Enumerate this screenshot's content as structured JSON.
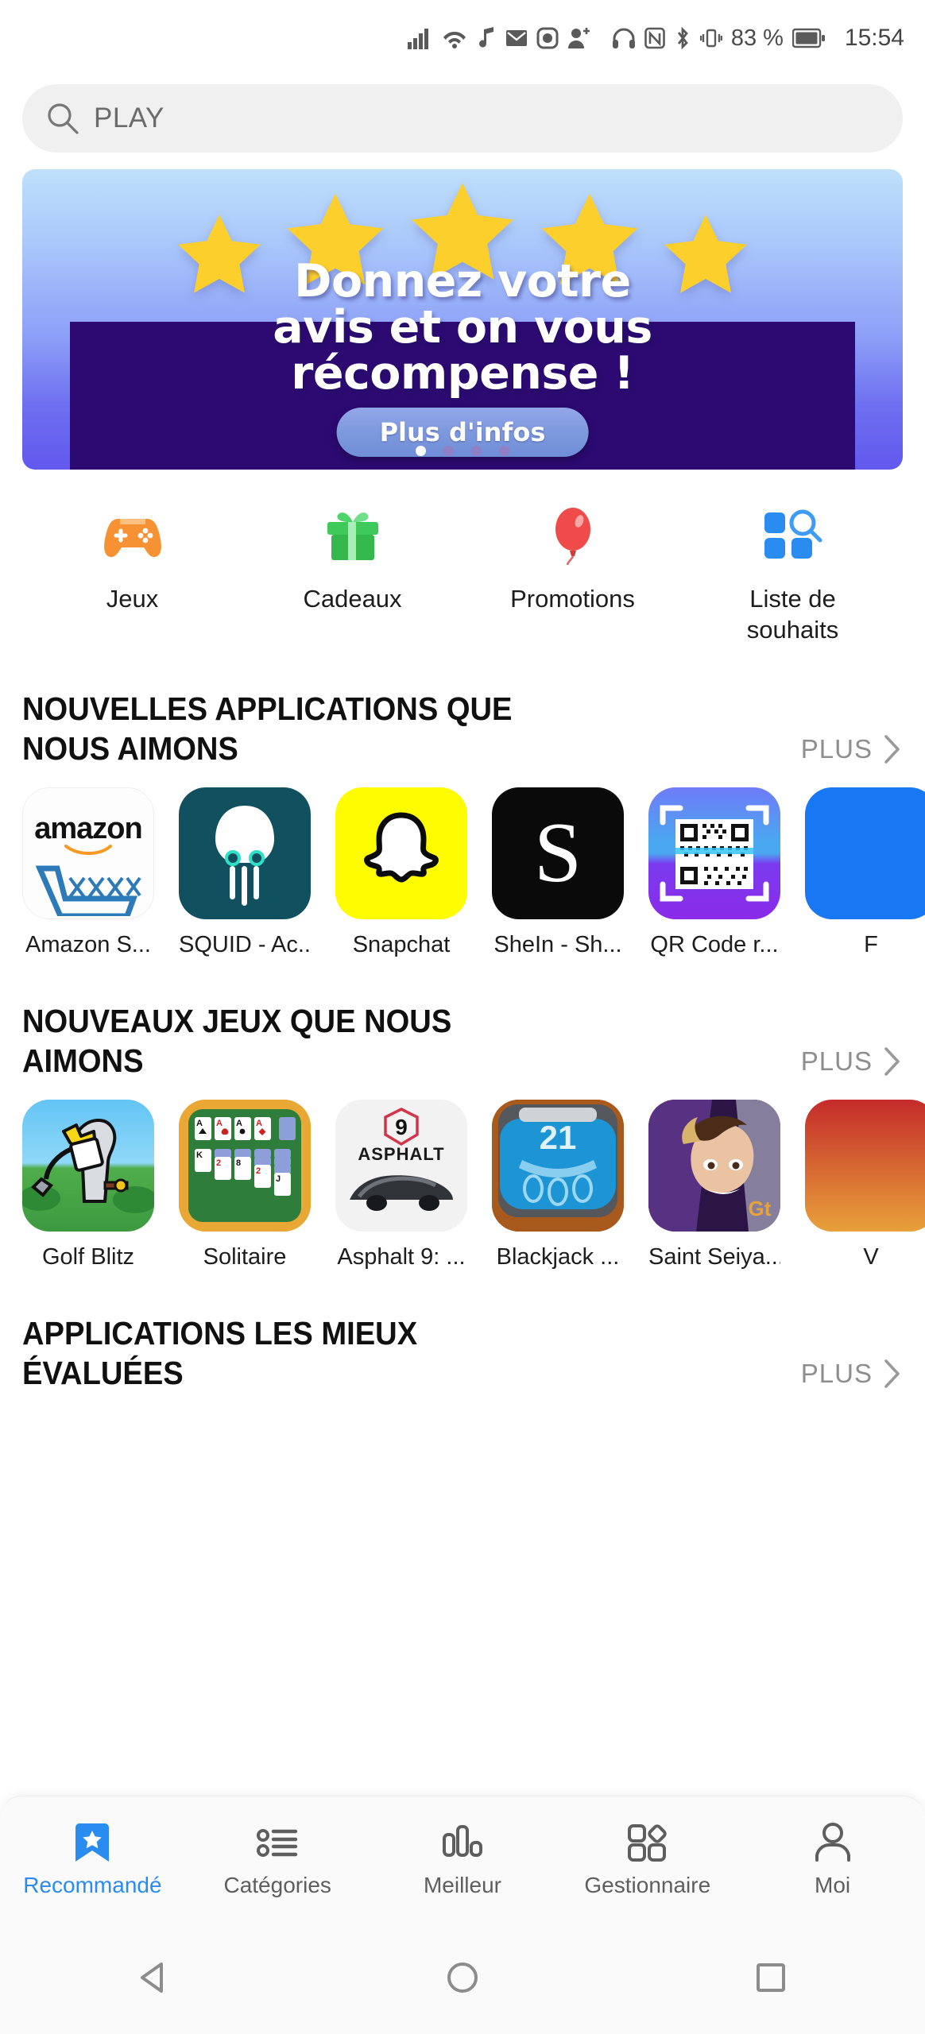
{
  "status_bar": {
    "icons": [
      "signal-bars-icon",
      "wifi-icon",
      "music-note-icon",
      "email-icon",
      "instagram-icon",
      "add-person-icon",
      "headphones-icon",
      "nfc-icon",
      "bluetooth-icon",
      "vibrate-icon"
    ],
    "battery_percent": "83 %",
    "time": "15:54"
  },
  "search": {
    "icon": "search-icon",
    "value": "PLAY",
    "placeholder": "PLAY"
  },
  "banner": {
    "title_lines": [
      "Donnez votre",
      "avis et on vous",
      "récompense !"
    ],
    "cta_label": "Plus d'infos",
    "dots_total": 4,
    "dot_active_index": 0,
    "star_count": 5,
    "colors": {
      "star": "#ffd02e",
      "panel": "#2c0a72",
      "cta": "#7f9ade"
    }
  },
  "quick_categories": [
    {
      "label": "Jeux",
      "icon": "gamepad-icon",
      "color": "#f79234"
    },
    {
      "label": "Cadeaux",
      "icon": "gift-icon",
      "color": "#3fc95a"
    },
    {
      "label": "Promotions",
      "icon": "balloon-icon",
      "color": "#ef4b4b"
    },
    {
      "label": "Liste de souhaits",
      "icon": "wishlist-grid-search-icon",
      "color": "#2a8cf0"
    }
  ],
  "sections": [
    {
      "title": "NOUVELLES APPLICATIONS QUE NOUS AIMONS",
      "more_label": "PLUS",
      "more_icon": "chevron-right-icon",
      "apps": [
        {
          "name": "Amazon S...",
          "icon": "amazon-app-icon"
        },
        {
          "name": "SQUID - Ac...",
          "icon": "squid-app-icon"
        },
        {
          "name": "Snapchat",
          "icon": "snapchat-app-icon"
        },
        {
          "name": "SheIn - Sh...",
          "icon": "shein-app-icon"
        },
        {
          "name": "QR Code r...",
          "icon": "qr-code-reader-app-icon"
        },
        {
          "name": "F",
          "icon": "facebook-app-icon"
        }
      ]
    },
    {
      "title": "NOUVEAUX JEUX QUE NOUS AIMONS",
      "more_label": "PLUS",
      "more_icon": "chevron-right-icon",
      "apps": [
        {
          "name": "Golf Blitz",
          "icon": "golf-blitz-app-icon"
        },
        {
          "name": "Solitaire",
          "icon": "solitaire-app-icon"
        },
        {
          "name": "Asphalt 9: ...",
          "icon": "asphalt-9-app-icon"
        },
        {
          "name": "Blackjack ...",
          "icon": "blackjack-app-icon"
        },
        {
          "name": "Saint Seiya...",
          "icon": "saint-seiya-app-icon"
        },
        {
          "name": "V",
          "icon": "partial-app-icon"
        }
      ]
    },
    {
      "title": "APPLICATIONS LES MIEUX ÉVALUÉES",
      "more_label": "PLUS",
      "more_icon": "chevron-right-icon",
      "apps": []
    }
  ],
  "tabbar": {
    "active_color": "#2a8cf0",
    "items": [
      {
        "label": "Recommandé",
        "icon": "bookmark-star-icon",
        "active": true
      },
      {
        "label": "Catégories",
        "icon": "list-bullets-icon",
        "active": false
      },
      {
        "label": "Meilleur",
        "icon": "bar-chart-icon",
        "active": false
      },
      {
        "label": "Gestionnaire",
        "icon": "grid-diamond-icon",
        "active": false
      },
      {
        "label": "Moi",
        "icon": "person-icon",
        "active": false
      }
    ]
  },
  "android_nav": {
    "items": [
      {
        "icon": "back-triangle-icon"
      },
      {
        "icon": "home-circle-icon"
      },
      {
        "icon": "recents-square-icon"
      }
    ]
  },
  "app_icon_text": {
    "amazon": "amazon",
    "shein_letter": "S",
    "asphalt_word": "ASPHALT",
    "asphalt_number": "9",
    "blackjack_number": "21",
    "saint_seiya_badge": "Gt"
  }
}
